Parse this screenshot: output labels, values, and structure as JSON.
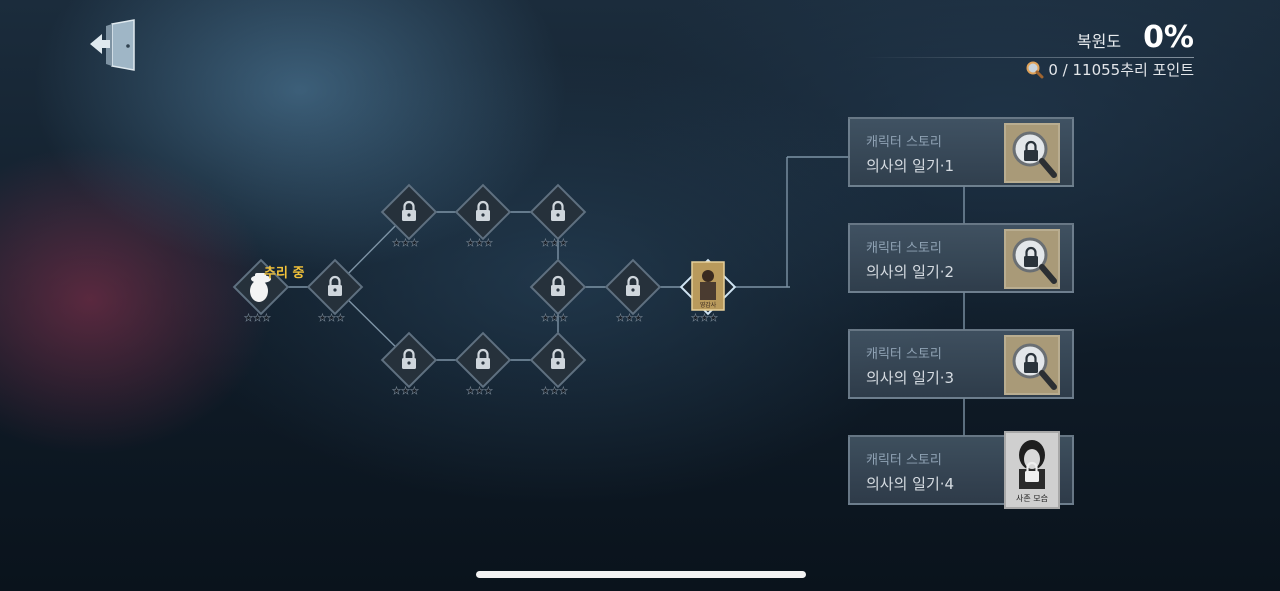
{
  "header": {
    "progress_label": "복원도",
    "progress_value": "0%",
    "points_text": "0 / 11055추리 포인트"
  },
  "tree": {
    "current_label": "추리 중",
    "portrait_caption": "영감사",
    "nodes": [
      {
        "id": "n0",
        "state": "current",
        "stars": 3
      },
      {
        "id": "n1",
        "state": "locked",
        "stars": 3
      },
      {
        "id": "n2",
        "state": "locked",
        "stars": 3
      },
      {
        "id": "n3",
        "state": "locked",
        "stars": 3
      },
      {
        "id": "n4",
        "state": "locked",
        "stars": 3
      },
      {
        "id": "n5",
        "state": "locked",
        "stars": 3
      },
      {
        "id": "n6",
        "state": "locked",
        "stars": 3
      },
      {
        "id": "n7",
        "state": "locked",
        "stars": 3
      },
      {
        "id": "n8",
        "state": "locked",
        "stars": 3
      },
      {
        "id": "n9",
        "state": "locked",
        "stars": 3
      },
      {
        "id": "n10",
        "state": "portrait",
        "stars": 3
      }
    ]
  },
  "stories": [
    {
      "category": "캐릭터 스토리",
      "title": "의사의 일기·1",
      "thumb_icon": "magnifier-lock-icon"
    },
    {
      "category": "캐릭터 스토리",
      "title": "의사의 일기·2",
      "thumb_icon": "magnifier-lock-icon"
    },
    {
      "category": "캐릭터 스토리",
      "title": "의사의 일기·3",
      "thumb_icon": "magnifier-lock-icon"
    },
    {
      "category": "캐릭터 스토리",
      "title": "의사의 일기·4",
      "thumb_icon": "portrait-lock-icon",
      "thumb_caption": "사존 모습"
    }
  ],
  "colors": {
    "current_label": "#f2c23a",
    "node_fill": "#2a3540",
    "card_bg": "#4a5a69"
  }
}
